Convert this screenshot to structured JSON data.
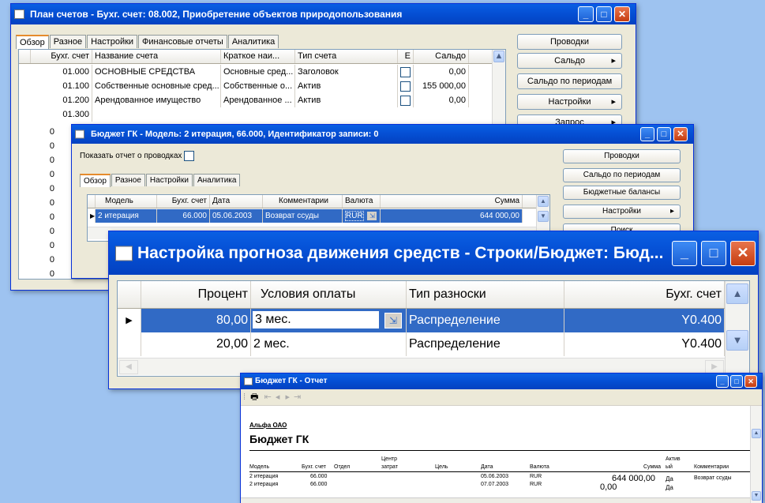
{
  "w1": {
    "title": "План счетов - Бухг. счет: 08.002, Приобретение объектов природопользования",
    "tabs": [
      "Обзор",
      "Разное",
      "Настройки",
      "Финансовые отчеты",
      "Аналитика"
    ],
    "headers": [
      "Бухг. счет",
      "Название счета",
      "Краткое наи...",
      "Тип счета",
      "Е",
      "Сальдо"
    ],
    "rows": [
      {
        "acc": "01.000",
        "name": "ОСНОВНЫЕ СРЕДСТВА",
        "short": "Основные сред...",
        "type": "Заголовок",
        "bal": "0,00"
      },
      {
        "acc": "01.100",
        "name": "Собственные основные сред...",
        "short": "Собственные о...",
        "type": "Актив",
        "bal": "155 000,00"
      },
      {
        "acc": "01.200",
        "name": "Арендованное имущество",
        "short": "Арендованное ...",
        "type": "Актив",
        "bal": "0,00"
      },
      {
        "acc": "01.300",
        "name": "",
        "short": "",
        "type": "",
        "bal": ""
      }
    ],
    "left_digits": [
      "0",
      "0",
      "0",
      "0",
      "0",
      "0",
      "0",
      "0",
      "0",
      "0",
      "0"
    ],
    "buttons": [
      "Проводки",
      "Сальдо",
      "Сальдо по периодам",
      "Настройки",
      "Запрос"
    ]
  },
  "w2": {
    "title": "Бюджет ГК - Модель: 2 итерация, 66.000, Идентификатор записи: 0",
    "show_label": "Показать отчет о проводках",
    "tabs": [
      "Обзор",
      "Разное",
      "Настройки",
      "Аналитика"
    ],
    "headers": [
      "Модель",
      "Бухг. счет",
      "Дата",
      "Комментарии",
      "Валюта",
      "Сумма"
    ],
    "row": {
      "model": "2 итерация",
      "acc": "66.000",
      "date": "05.06.2003",
      "comment": "Возврат ссуды",
      "cur": "RUR",
      "sum": "644 000,00"
    },
    "buttons": [
      "Проводки",
      "Сальдо по периодам",
      "Бюджетные балансы",
      "Настройки",
      "Поиск"
    ]
  },
  "w3": {
    "title": "Настройка прогноза движения средств - Строки/Бюджет: Бюд...",
    "headers": [
      "Процент",
      "Условия оплаты",
      "Тип разноски",
      "Бухг. счет"
    ],
    "rows": [
      {
        "pct": "80,00",
        "terms": "3 мес.",
        "type": "Распределение",
        "acc": "Y0.400"
      },
      {
        "pct": "20,00",
        "terms": "2 мес.",
        "type": "Распределение",
        "acc": "Y0.400"
      }
    ]
  },
  "w4": {
    "title": "Бюджет ГК - Отчет",
    "company": "Альфа ОАО",
    "report_title": "Бюджет ГК",
    "headers": {
      "model": "Модель",
      "acc": "Бухг. счет",
      "dept": "Отдел",
      "cc1": "Центр",
      "cc2": "затрат",
      "goal": "Цель",
      "date": "Дата",
      "cur": "Валюта",
      "sum": "Сумма",
      "act1": "Актив",
      "act2": "ый",
      "comm": "Комментарии"
    },
    "rows": [
      {
        "model": "2 итерация",
        "acc": "66.000",
        "date": "05.06.2003",
        "cur": "RUR",
        "sum": "644 000,00",
        "act": "Да",
        "comm": "Возврат ссуды"
      },
      {
        "model": "2 итерация",
        "acc": "66.000",
        "date": "07.07.2003",
        "cur": "RUR",
        "sum": "0,00",
        "act": "Да",
        "comm": ""
      }
    ]
  }
}
